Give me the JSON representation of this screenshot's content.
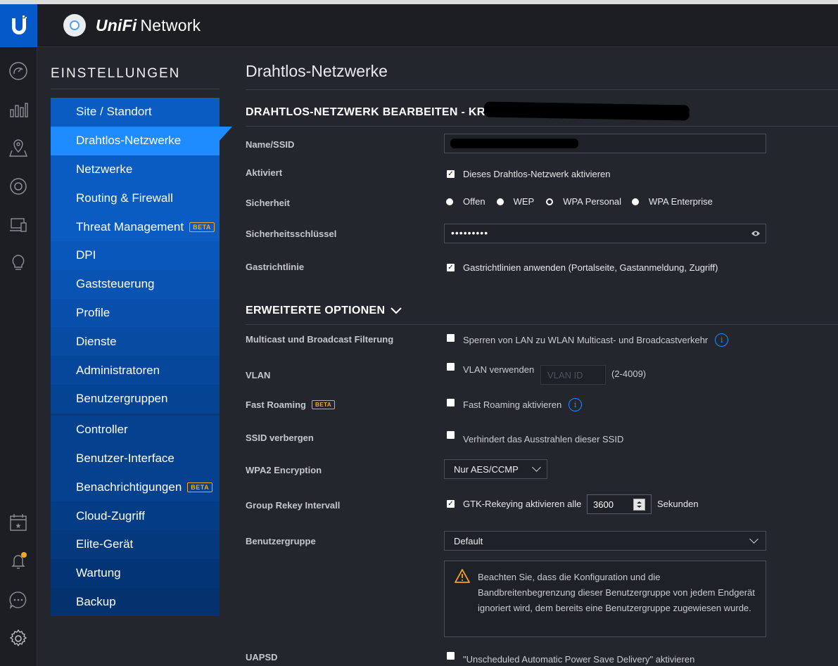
{
  "app": {
    "brand_italic": "UniFi",
    "brand_name": "Network"
  },
  "settings": {
    "title": "EINSTELLUNGEN",
    "menu_top": [
      {
        "label": "Site / Standort"
      },
      {
        "label": "Drahtlos-Netzwerke",
        "active": true
      },
      {
        "label": "Netzwerke"
      },
      {
        "label": "Routing & Firewall"
      },
      {
        "label": "Threat Management",
        "badge": "BETA"
      },
      {
        "label": "DPI"
      },
      {
        "label": "Gaststeuerung"
      },
      {
        "label": "Profile"
      },
      {
        "label": "Dienste"
      },
      {
        "label": "Administratoren"
      },
      {
        "label": "Benutzergruppen"
      }
    ],
    "menu_bottom": [
      {
        "label": "Controller"
      },
      {
        "label": "Benutzer-Interface"
      },
      {
        "label": "Benachrichtigungen",
        "badge": "BETA"
      },
      {
        "label": "Cloud-Zugriff"
      },
      {
        "label": "Elite-Gerät"
      },
      {
        "label": "Wartung"
      },
      {
        "label": "Backup"
      }
    ]
  },
  "iconbar": {
    "icons": [
      "dashboard-icon",
      "statistics-icon",
      "map-icon",
      "devices-icon",
      "clients-icon",
      "insights-icon",
      "events-icon",
      "alerts-icon",
      "chat-icon",
      "settings-icon"
    ]
  },
  "page": {
    "title": "Drahtlos-Netzwerke",
    "edit_heading": "DRAHTLOS-NETZWERK BEARBEITEN - KR",
    "advanced_heading": "ERWEITERTE OPTIONEN"
  },
  "form": {
    "name_label": "Name/SSID",
    "enabled_label": "Aktiviert",
    "enabled_text": "Dieses Drahtlos-Netzwerk aktivieren",
    "enabled_checked": true,
    "security_label": "Sicherheit",
    "security_options": [
      "Offen",
      "WEP",
      "WPA Personal",
      "WPA Enterprise"
    ],
    "security_selected": "WPA Personal",
    "key_label": "Sicherheitsschlüssel",
    "key_masked": "•••••••••",
    "guest_label": "Gastrichtlinie",
    "guest_text": "Gastrichtlinien anwenden (Portalseite, Gastanmeldung, Zugriff)",
    "guest_checked": true
  },
  "advanced": {
    "multicast_label": "Multicast und Broadcast Filterung",
    "multicast_text": "Sperren von LAN zu WLAN Multicast- und Broadcastverkehr",
    "vlan_label": "VLAN",
    "vlan_text": "VLAN verwenden",
    "vlan_placeholder": "VLAN ID",
    "vlan_range": "(2-4009)",
    "fast_roaming_label": "Fast Roaming",
    "fast_roaming_badge": "BETA",
    "fast_roaming_text": "Fast Roaming aktivieren",
    "ssid_hide_label": "SSID verbergen",
    "ssid_hide_text": "Verhindert das Ausstrahlen dieser SSID",
    "wpa2_label": "WPA2 Encryption",
    "wpa2_value": "Nur AES/CCMP",
    "rekey_label": "Group Rekey Intervall",
    "rekey_text": "GTK-Rekeying aktivieren alle",
    "rekey_value": "3600",
    "rekey_unit": "Sekunden",
    "rekey_checked": true,
    "usergroup_label": "Benutzergruppe",
    "usergroup_value": "Default",
    "warning_text": "Beachten Sie, dass die Konfiguration und die Bandbreitenbegrenzung dieser Benutzergruppe von jedem Endgerät ignoriert wird, dem bereits eine Benutzergruppe zugewiesen wurde.",
    "uapsd_label": "UAPSD",
    "uapsd_text": "\"Unscheduled Automatic Power Save Delivery\" aktivieren"
  }
}
